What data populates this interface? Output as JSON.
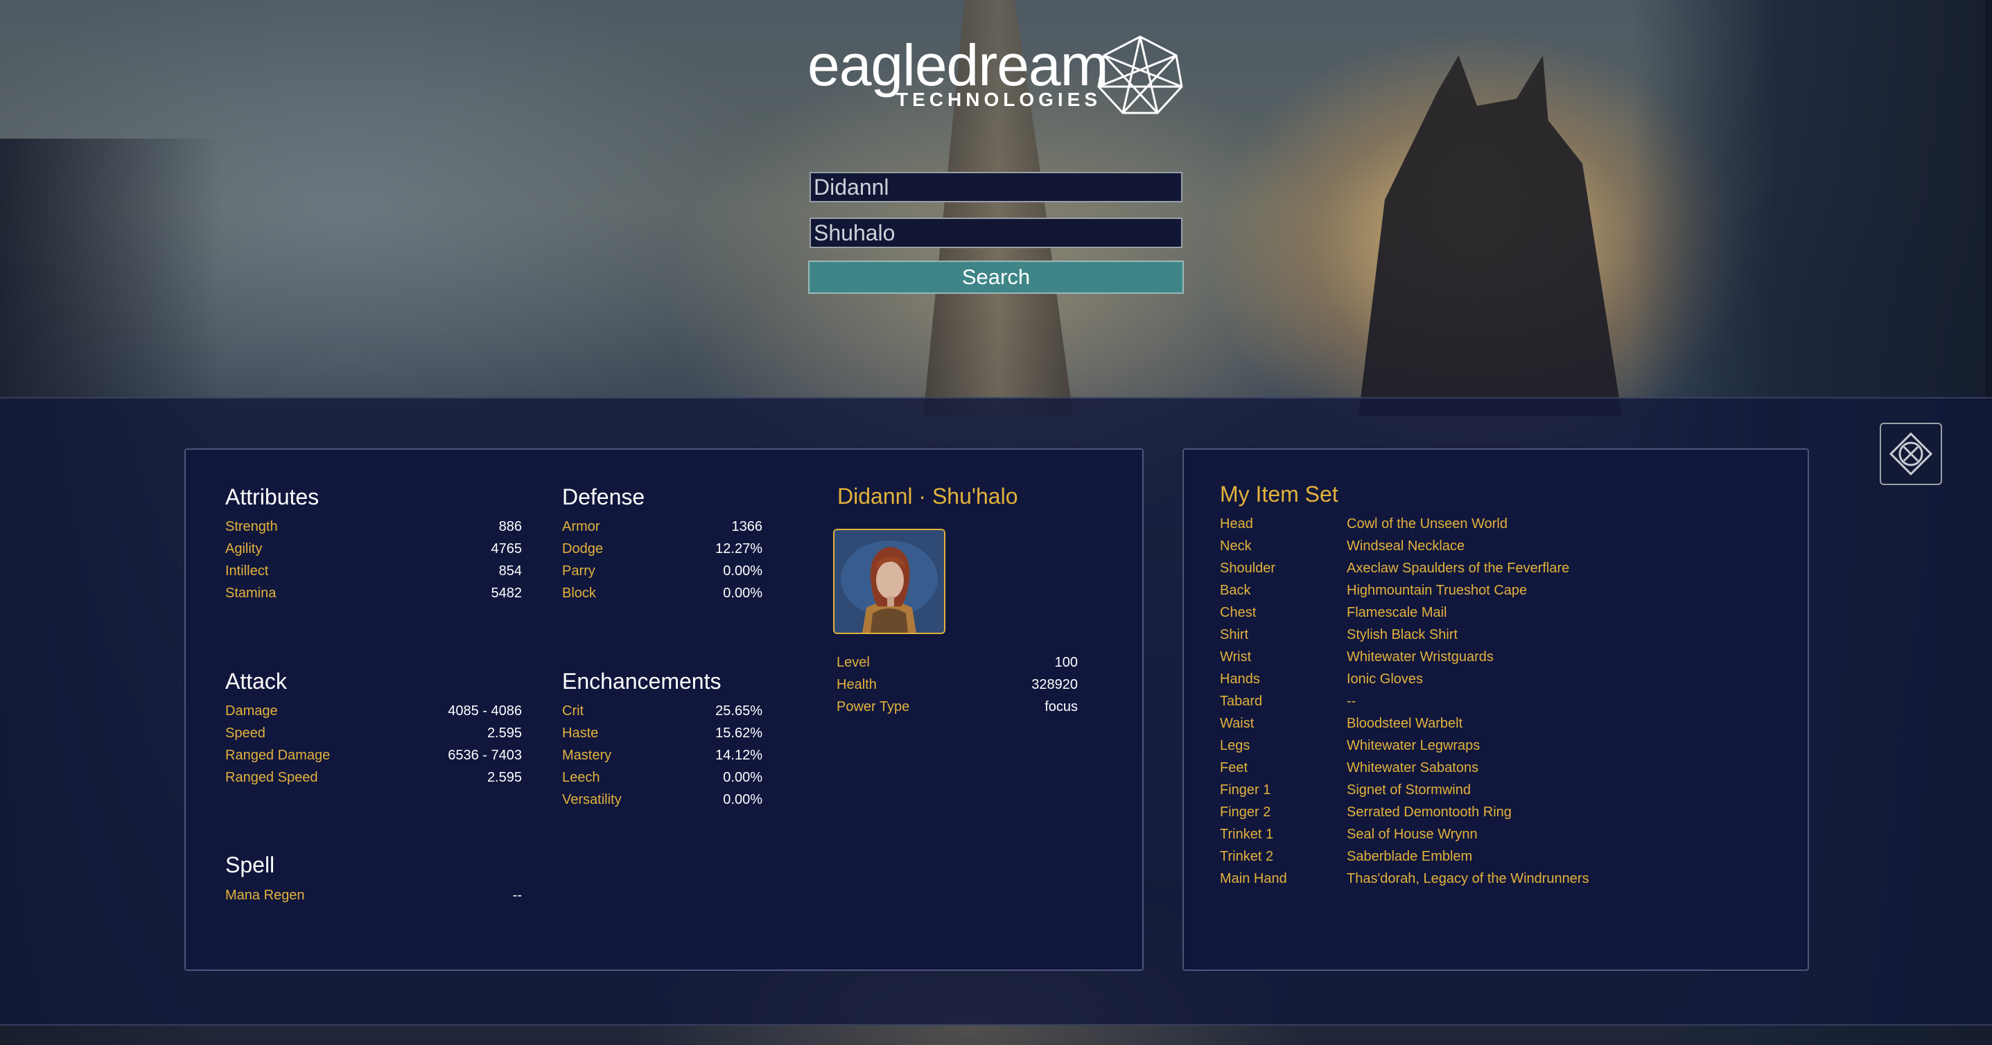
{
  "header": {
    "logo_word": "eagledream",
    "logo_sub": "TECHNOLOGIES",
    "character_field_value": "Didannl",
    "realm_field_value": "Shuhalo",
    "search_label": "Search"
  },
  "character": {
    "title": "Didannl · Shu'halo",
    "stats": [
      {
        "label": "Level",
        "value": "100"
      },
      {
        "label": "Health",
        "value": "328920"
      },
      {
        "label": "Power Type",
        "value": "focus"
      }
    ]
  },
  "attributes": {
    "title": "Attributes",
    "rows": [
      {
        "label": "Strength",
        "value": "886"
      },
      {
        "label": "Agility",
        "value": "4765"
      },
      {
        "label": "Intillect",
        "value": "854"
      },
      {
        "label": "Stamina",
        "value": "5482"
      }
    ]
  },
  "attack": {
    "title": "Attack",
    "rows": [
      {
        "label": "Damage",
        "value": "4085 - 4086"
      },
      {
        "label": "Speed",
        "value": "2.595"
      },
      {
        "label": "Ranged Damage",
        "value": "6536 - 7403"
      },
      {
        "label": "Ranged Speed",
        "value": "2.595"
      }
    ]
  },
  "spell": {
    "title": "Spell",
    "rows": [
      {
        "label": "Mana Regen",
        "value": "--"
      }
    ]
  },
  "defense": {
    "title": "Defense",
    "rows": [
      {
        "label": "Armor",
        "value": "1366"
      },
      {
        "label": "Dodge",
        "value": "12.27%"
      },
      {
        "label": "Parry",
        "value": "0.00%"
      },
      {
        "label": "Block",
        "value": "0.00%"
      }
    ]
  },
  "enchancements": {
    "title": "Enchancements",
    "rows": [
      {
        "label": "Crit",
        "value": "25.65%"
      },
      {
        "label": "Haste",
        "value": "15.62%"
      },
      {
        "label": "Mastery",
        "value": "14.12%"
      },
      {
        "label": "Leech",
        "value": "0.00%"
      },
      {
        "label": "Versatility",
        "value": "0.00%"
      }
    ]
  },
  "item_set": {
    "title": "My Item Set",
    "items": [
      {
        "slot": "Head",
        "name": "Cowl of the Unseen World"
      },
      {
        "slot": "Neck",
        "name": "Windseal Necklace"
      },
      {
        "slot": "Shoulder",
        "name": "Axeclaw Spaulders of the Feverflare"
      },
      {
        "slot": "Back",
        "name": "Highmountain Trueshot Cape"
      },
      {
        "slot": "Chest",
        "name": "Flamescale Mail"
      },
      {
        "slot": "Shirt",
        "name": "Stylish Black Shirt"
      },
      {
        "slot": "Wrist",
        "name": "Whitewater Wristguards"
      },
      {
        "slot": "Hands",
        "name": "Ionic Gloves"
      },
      {
        "slot": "Tabard",
        "name": "--"
      },
      {
        "slot": "Waist",
        "name": "Bloodsteel Warbelt"
      },
      {
        "slot": "Legs",
        "name": "Whitewater Legwraps"
      },
      {
        "slot": "Feet",
        "name": "Whitewater Sabatons"
      },
      {
        "slot": "Finger 1",
        "name": "Signet of Stormwind"
      },
      {
        "slot": "Finger 2",
        "name": "Serrated Demontooth Ring"
      },
      {
        "slot": "Trinket 1",
        "name": "Seal of House Wrynn"
      },
      {
        "slot": "Trinket 2",
        "name": "Saberblade Emblem"
      },
      {
        "slot": "Main Hand",
        "name": "Thas'dorah, Legacy of the Windrunners"
      }
    ]
  },
  "icons": {
    "logo_mark": "geodesic-sphere-icon",
    "close": "close-icon"
  }
}
